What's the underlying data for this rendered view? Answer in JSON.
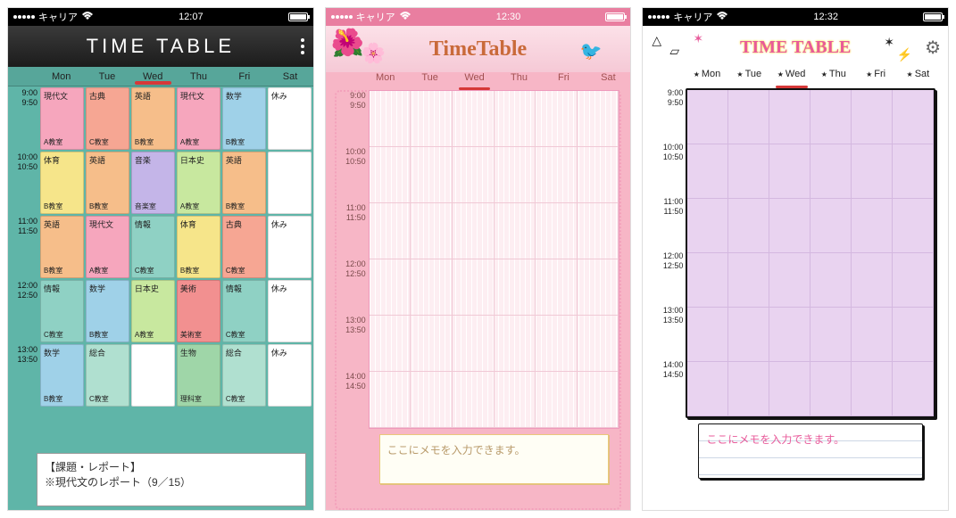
{
  "carrier": "キャリア",
  "days": [
    "Mon",
    "Tue",
    "Wed",
    "Thu",
    "Fri",
    "Sat"
  ],
  "today_index": 2,
  "time_slots": [
    {
      "start": "9:00",
      "end": "9:50"
    },
    {
      "start": "10:00",
      "end": "10:50"
    },
    {
      "start": "11:00",
      "end": "11:50"
    },
    {
      "start": "12:00",
      "end": "12:50"
    },
    {
      "start": "13:00",
      "end": "13:50"
    },
    {
      "start": "14:00",
      "end": "14:50"
    }
  ],
  "screen_a": {
    "time": "12:07",
    "title": "TIME TABLE",
    "memo_line1": "【課題・レポート】",
    "memo_line2": "※現代文のレポート（9／15）",
    "colors": {
      "pink": "#f6a6bd",
      "orange": "#f6be8a",
      "yellow": "#f6e58a",
      "sky": "#9fd1e8",
      "blue": "#8fb5e8",
      "green": "#9fd6a8",
      "teal": "#8fd1c4",
      "salmon": "#f6a693",
      "purple": "#c4b5e8",
      "lime": "#c8e89f",
      "mint": "#b0e0d0",
      "grey": "#d8d8d8",
      "white": "#ffffff",
      "red": "#f29090",
      "lav": "#d3c5e8"
    },
    "grid": [
      [
        {
          "s": "現代文",
          "r": "A教室",
          "c": "pink"
        },
        {
          "s": "古典",
          "r": "C教室",
          "c": "salmon"
        },
        {
          "s": "英語",
          "r": "B教室",
          "c": "orange"
        },
        {
          "s": "現代文",
          "r": "A教室",
          "c": "pink"
        },
        {
          "s": "数学",
          "r": "B教室",
          "c": "sky"
        },
        {
          "s": "休み",
          "r": "",
          "c": "white"
        }
      ],
      [
        {
          "s": "体育",
          "r": "B教室",
          "c": "yellow"
        },
        {
          "s": "英語",
          "r": "B教室",
          "c": "orange"
        },
        {
          "s": "音楽",
          "r": "音楽室",
          "c": "purple"
        },
        {
          "s": "日本史",
          "r": "A教室",
          "c": "lime"
        },
        {
          "s": "英語",
          "r": "B教室",
          "c": "orange"
        },
        {
          "s": "",
          "r": "",
          "c": "white"
        }
      ],
      [
        {
          "s": "英語",
          "r": "B教室",
          "c": "orange"
        },
        {
          "s": "現代文",
          "r": "A教室",
          "c": "pink"
        },
        {
          "s": "情報",
          "r": "C教室",
          "c": "teal"
        },
        {
          "s": "体育",
          "r": "B教室",
          "c": "yellow"
        },
        {
          "s": "古典",
          "r": "C教室",
          "c": "salmon"
        },
        {
          "s": "休み",
          "r": "",
          "c": "white"
        }
      ],
      [
        {
          "s": "情報",
          "r": "C教室",
          "c": "teal"
        },
        {
          "s": "数学",
          "r": "B教室",
          "c": "sky"
        },
        {
          "s": "日本史",
          "r": "A教室",
          "c": "lime"
        },
        {
          "s": "美術",
          "r": "美術室",
          "c": "red"
        },
        {
          "s": "情報",
          "r": "C教室",
          "c": "teal"
        },
        {
          "s": "休み",
          "r": "",
          "c": "white"
        }
      ],
      [
        {
          "s": "数学",
          "r": "B教室",
          "c": "sky"
        },
        {
          "s": "総合",
          "r": "C教室",
          "c": "mint"
        },
        {
          "s": "",
          "r": "",
          "c": "white"
        },
        {
          "s": "生物",
          "r": "理科室",
          "c": "green"
        },
        {
          "s": "総合",
          "r": "C教室",
          "c": "mint"
        },
        {
          "s": "休み",
          "r": "",
          "c": "white"
        }
      ]
    ]
  },
  "screen_b": {
    "time": "12:30",
    "title": "TimeTable",
    "memo_placeholder": "ここにメモを入力できます。"
  },
  "screen_c": {
    "time": "12:32",
    "title": "TIME TABLE",
    "memo_placeholder": "ここにメモを入力できます。"
  }
}
